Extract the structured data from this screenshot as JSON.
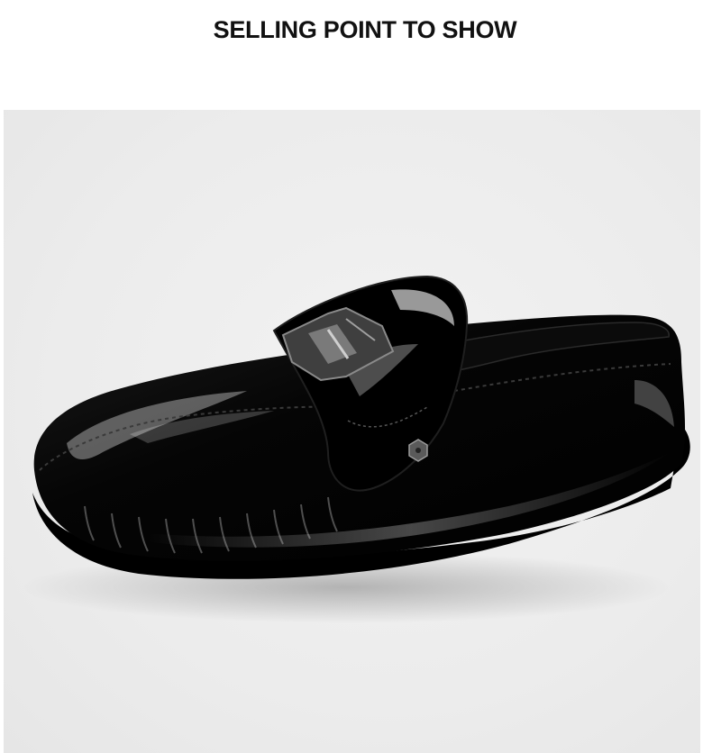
{
  "header": {
    "title": "SELLING POINT TO SHOW"
  },
  "product_image": {
    "subject": "black-patent-leather-loafer-icon",
    "background_color": "#ececec",
    "leather_color": "#050505",
    "hardware_color": "#6b6b6b"
  }
}
